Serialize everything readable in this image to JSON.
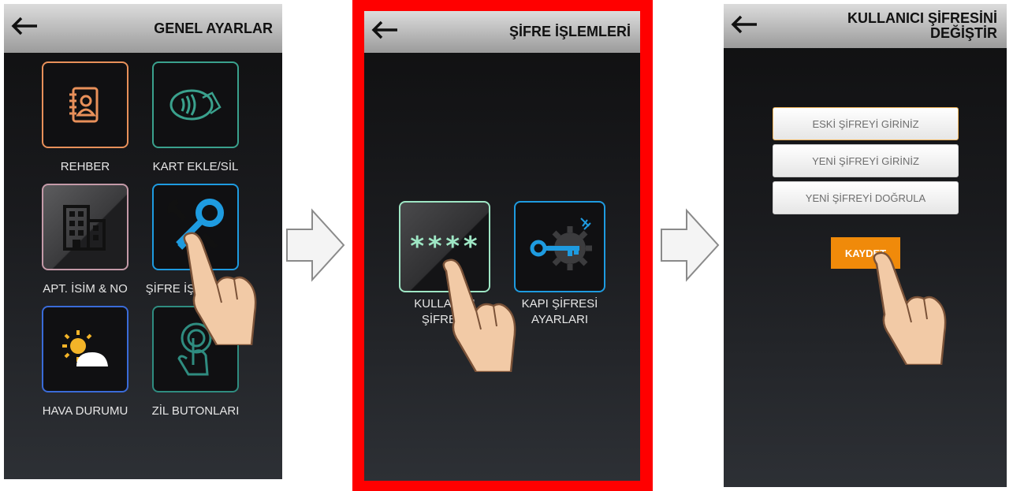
{
  "screens": {
    "general": {
      "title": "GENEL AYARLAR",
      "tiles": [
        {
          "label": "REHBER",
          "color": "#e8905a"
        },
        {
          "label": "KART EKLE/SİL",
          "color": "#3aa18d"
        },
        {
          "label": "APT. İSİM & NO",
          "color": "#c49aa8"
        },
        {
          "label": "ŞİFRE İŞLEMLERİ",
          "color": "#1e9be0"
        },
        {
          "label": "HAVA DURUMU",
          "color": "#3a6bd8"
        },
        {
          "label": "ZİL BUTONLARI",
          "color": "#2f8c80"
        }
      ]
    },
    "password_ops": {
      "title": "ŞİFRE İŞLEMLERİ",
      "tiles": [
        {
          "label": "KULLANICI ŞİFRESİ",
          "icon_text": "****",
          "color": "#9ee6c4"
        },
        {
          "label": "KAPI ŞİFRESİ AYARLARI",
          "color": "#1e9be0"
        }
      ],
      "highlight_color": "#ff0000"
    },
    "change_password": {
      "title_line1": "KULLANICI ŞİFRESİNİ",
      "title_line2": "DEĞİŞTİR",
      "fields": {
        "old": "ESKİ ŞİFREYİ GİRİNİZ",
        "new": "YENİ ŞİFREYİ GİRİNİZ",
        "confirm": "YENİ ŞİFREYİ DOĞRULA"
      },
      "save_label": "KAYDET",
      "save_color": "#f08a0a"
    }
  },
  "icons": [
    "back-arrow-icon",
    "contacts-book-icon",
    "card-contactless-icon",
    "building-icon",
    "wrench-key-icon",
    "weather-icon",
    "touch-bell-icon",
    "password-asterisk-icon",
    "key-gear-icon",
    "hand-pointer-icon",
    "next-arrow-icon"
  ]
}
